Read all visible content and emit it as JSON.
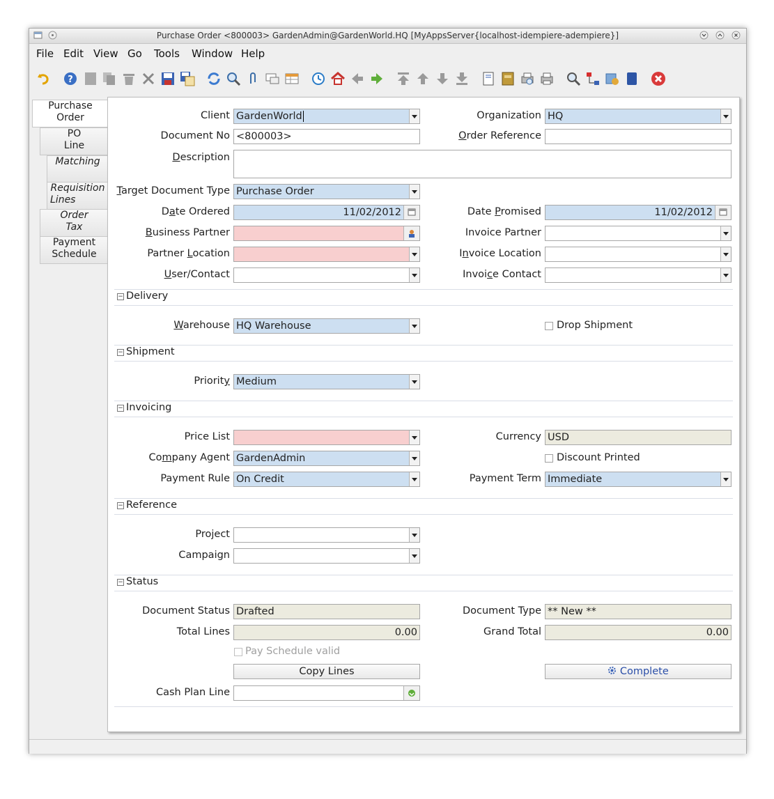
{
  "window": {
    "title": "Purchase Order  <800003>  GardenAdmin@GardenWorld.HQ [MyAppsServer{localhost-idempiere-adempiere}]"
  },
  "menu": [
    "File",
    "Edit",
    "View",
    "Go",
    "Tools",
    "Window",
    "Help"
  ],
  "tabs": [
    {
      "l1": "Purchase",
      "l2": "Order"
    },
    {
      "l1": "PO",
      "l2": "Line"
    },
    {
      "l1": "Matching",
      "l2": ""
    },
    {
      "l1": "Requisition",
      "l2": "Lines"
    },
    {
      "l1": "Order",
      "l2": "Tax"
    },
    {
      "l1": "Payment",
      "l2": "Schedule"
    }
  ],
  "form": {
    "client": {
      "label": "Client",
      "value": "GardenWorld"
    },
    "organization": {
      "label": "Organization",
      "value": "HQ"
    },
    "document_no": {
      "label": "Document No",
      "value": "<800003>"
    },
    "order_reference": {
      "label": "Order Reference",
      "value": ""
    },
    "description": {
      "label": "Description",
      "value": ""
    },
    "target_doc_type": {
      "label": "Target Document Type",
      "value": "Purchase Order"
    },
    "date_ordered": {
      "label": "Date Ordered",
      "value": "11/02/2012"
    },
    "date_promised": {
      "label": "Date Promised",
      "value": "11/02/2012"
    },
    "business_partner": {
      "label": "Business Partner",
      "value": ""
    },
    "invoice_partner": {
      "label": "Invoice Partner",
      "value": ""
    },
    "partner_location": {
      "label": "Partner Location",
      "value": ""
    },
    "invoice_location": {
      "label": "Invoice Location",
      "value": ""
    },
    "user_contact": {
      "label": "User/Contact",
      "value": ""
    },
    "invoice_contact": {
      "label": "Invoice Contact",
      "value": ""
    }
  },
  "sections": {
    "delivery": "Delivery",
    "shipment": "Shipment",
    "invoicing": "Invoicing",
    "reference": "Reference",
    "status": "Status"
  },
  "delivery": {
    "warehouse": {
      "label": "Warehouse",
      "value": "HQ Warehouse"
    },
    "drop_shipment": {
      "label": "Drop Shipment",
      "checked": false
    }
  },
  "shipment": {
    "priority": {
      "label": "Priority",
      "value": "Medium"
    }
  },
  "invoicing": {
    "price_list": {
      "label": "Price List",
      "value": ""
    },
    "currency": {
      "label": "Currency",
      "value": "USD"
    },
    "company_agent": {
      "label": "Company Agent",
      "value": "GardenAdmin"
    },
    "discount_printed": {
      "label": "Discount Printed",
      "checked": false
    },
    "payment_rule": {
      "label": "Payment Rule",
      "value": "On Credit"
    },
    "payment_term": {
      "label": "Payment Term",
      "value": "Immediate"
    }
  },
  "reference": {
    "project": {
      "label": "Project",
      "value": ""
    },
    "campaign": {
      "label": "Campaign",
      "value": ""
    }
  },
  "status": {
    "document_status": {
      "label": "Document Status",
      "value": "Drafted"
    },
    "document_type": {
      "label": "Document Type",
      "value": "** New **"
    },
    "total_lines": {
      "label": "Total Lines",
      "value": "0.00"
    },
    "grand_total": {
      "label": "Grand Total",
      "value": "0.00"
    },
    "pay_schedule_valid": {
      "label": "Pay Schedule valid",
      "checked": false
    },
    "copy_lines": "Copy Lines",
    "complete": "Complete",
    "cash_plan_line": {
      "label": "Cash Plan Line",
      "value": ""
    }
  },
  "colors": {
    "mandatory": "#f8cfcf",
    "editable": "#cddff1",
    "readonly": "#ecebdf"
  },
  "toolbar_icons": [
    "undo-icon",
    "help-icon",
    "new-icon",
    "copy-icon",
    "delete-icon",
    "delete-selection-icon",
    "save-icon",
    "save-new-icon",
    "refresh-icon",
    "find-icon",
    "attachment-icon",
    "chat-icon",
    "grid-toggle-icon",
    "history-icon",
    "home-icon",
    "previous-icon",
    "next-icon",
    "first-record-icon",
    "parent-record-icon",
    "detail-record-icon",
    "last-record-icon",
    "report-icon",
    "archive-icon",
    "print-preview-icon",
    "print-icon",
    "zoom-across-icon",
    "workflow-icon",
    "request-icon",
    "product-info-icon",
    "end-icon"
  ]
}
